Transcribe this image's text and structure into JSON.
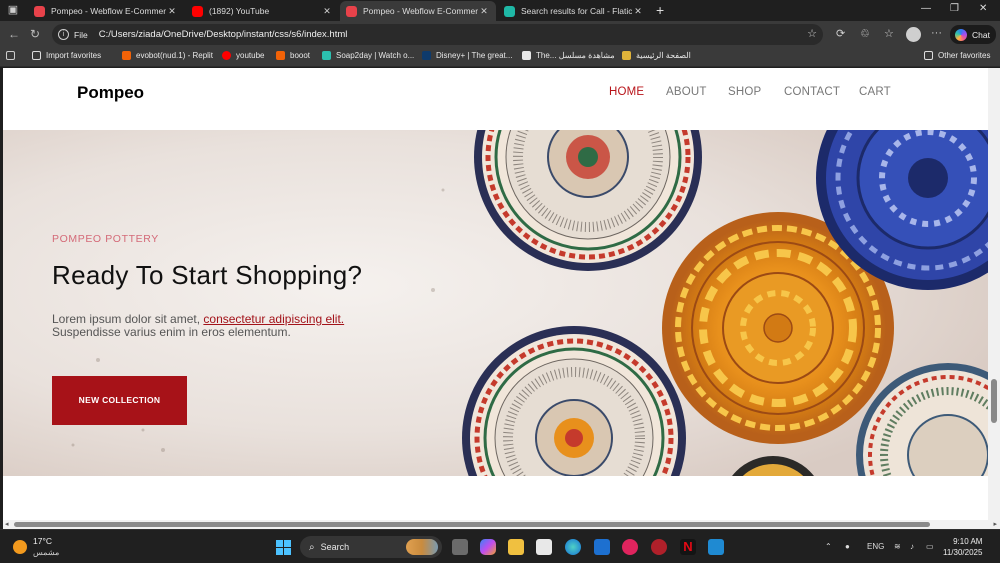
{
  "browser": {
    "tabs": [
      {
        "title": "Pompeo - Webflow E-Commerce",
        "favicon_color": "#e8424a",
        "active": false
      },
      {
        "title": "(1892) YouTube",
        "favicon_color": "#ff0000",
        "active": false
      },
      {
        "title": "Pompeo - Webflow E-Commerce",
        "favicon_color": "#e8424a",
        "active": true
      },
      {
        "title": "Search results for Call - Flaticon",
        "favicon_color": "#1fb8a6",
        "active": false
      }
    ],
    "address": {
      "scheme_label": "File",
      "url": "C:/Users/ziada/OneDrive/Desktop/instant/css/s6/index.html"
    },
    "chat_label": "Chat",
    "favorites": [
      {
        "label": "Import favorites",
        "icon": "import-icon"
      },
      {
        "label": "evobot(nud.1) - Replit",
        "icon": "replit-icon"
      },
      {
        "label": "youtube",
        "icon": "youtube-icon"
      },
      {
        "label": "booot",
        "icon": "replit-icon"
      },
      {
        "label": "Soap2day | Watch o...",
        "icon": "soap2day-icon"
      },
      {
        "label": "Disney+ | The great...",
        "icon": "disney-icon"
      },
      {
        "label": "The... مشاهدة مسلسل",
        "icon": "page-icon"
      },
      {
        "label": "الصفحة الرئيسية",
        "icon": "home-folder-icon"
      }
    ],
    "other_favorites_label": "Other favorites"
  },
  "site": {
    "brand": "Pompeo",
    "nav": [
      {
        "label": "HOME",
        "current": true
      },
      {
        "label": "ABOUT",
        "current": false
      },
      {
        "label": "SHOP",
        "current": false
      },
      {
        "label": "CONTACT",
        "current": false
      },
      {
        "label": "CART",
        "current": false
      }
    ],
    "hero": {
      "eyebrow": "POMPEO POTTERY",
      "title": "Ready To Start Shopping?",
      "body_plain": "Lorem ipsum dolor sit amet, ",
      "body_link": "consectetur adipiscing elit.",
      "body_line2": "Suspendisse varius enim in eros elementum.",
      "cta_label": "NEW COLLECTION"
    },
    "colors": {
      "accent": "#a71218",
      "eyebrow": "#d46a78"
    }
  },
  "taskbar": {
    "weather_temp": "17°C",
    "weather_desc": "مشمس",
    "search_label": "Search",
    "language": "ENG",
    "time": "9:10 AM",
    "date": "11/30/2025"
  }
}
